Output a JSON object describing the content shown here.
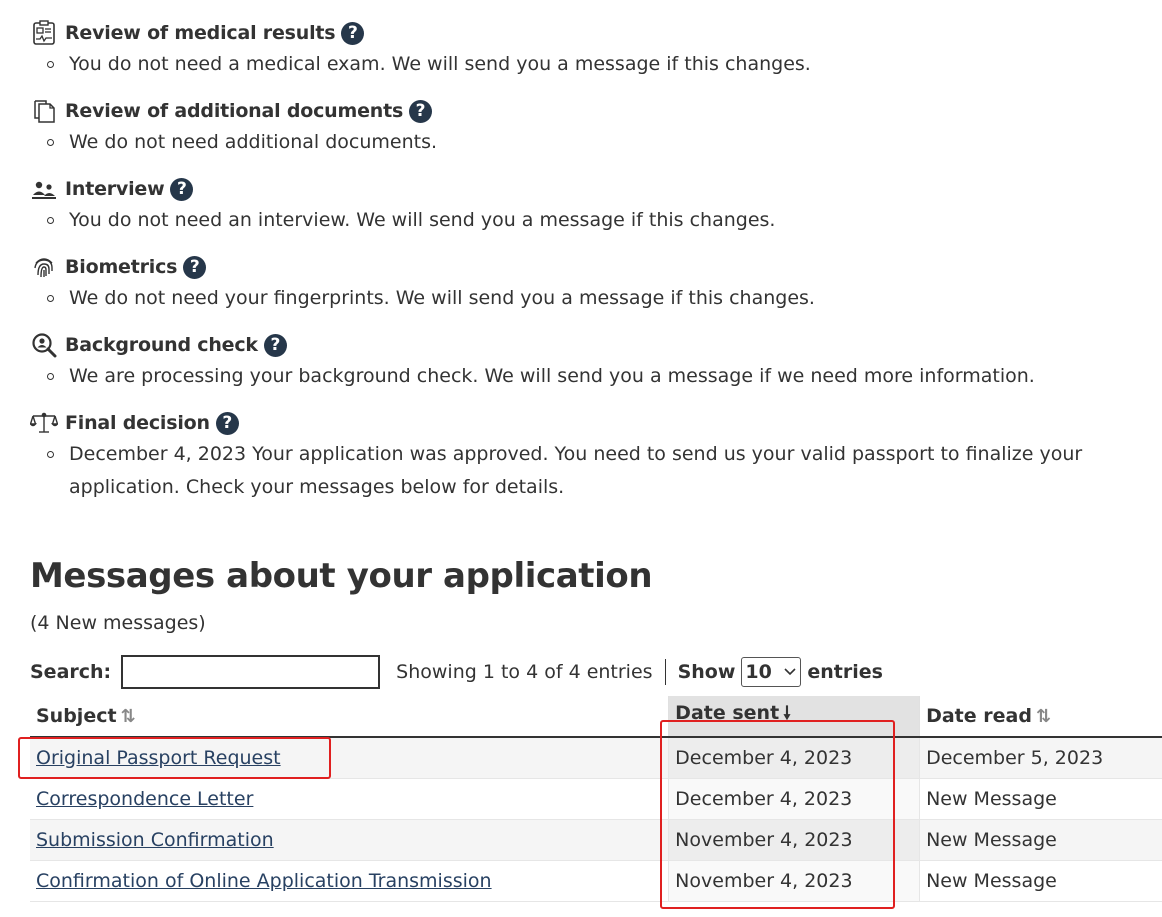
{
  "steps": [
    {
      "icon": "medical-clipboard-icon",
      "title": "Review of medical results",
      "desc": "You do not need a medical exam. We will send you a message if this changes."
    },
    {
      "icon": "documents-icon",
      "title": "Review of additional documents",
      "desc": "We do not need additional documents."
    },
    {
      "icon": "people-icon",
      "title": "Interview",
      "desc": "You do not need an interview. We will send you a message if this changes."
    },
    {
      "icon": "fingerprint-icon",
      "title": "Biometrics",
      "desc": "We do not need your fingerprints. We will send you a message if this changes."
    },
    {
      "icon": "search-person-icon",
      "title": "Background check",
      "desc": "We are processing your background check. We will send you a message if we need more information."
    },
    {
      "icon": "scales-icon",
      "title": "Final decision",
      "desc": "December 4, 2023 Your application was approved. You need to send us your valid passport to finalize your application. Check your messages below for details."
    }
  ],
  "help_glyph": "?",
  "messages": {
    "title": "Messages about your application",
    "count": "(4 New messages)",
    "search_label": "Search:",
    "search_value": "",
    "showing": "Showing 1 to 4 of 4 entries",
    "show_label": "Show",
    "show_value": "10",
    "entries_label": "entries",
    "columns": [
      "Subject",
      "Date sent",
      "Date read"
    ],
    "rows": [
      {
        "subject": "Original Passport Request",
        "date_sent": "December 4, 2023",
        "date_read": "December 5, 2023"
      },
      {
        "subject": "Correspondence Letter",
        "date_sent": "December 4, 2023",
        "date_read": "New Message"
      },
      {
        "subject": "Submission Confirmation",
        "date_sent": "November 4, 2023",
        "date_read": "New Message"
      },
      {
        "subject": "Confirmation of Online Application Transmission",
        "date_sent": "November 4, 2023",
        "date_read": "New Message"
      }
    ]
  },
  "colors": {
    "help_bg": "#26374a",
    "link": "#284162",
    "highlight": "#e02020"
  }
}
